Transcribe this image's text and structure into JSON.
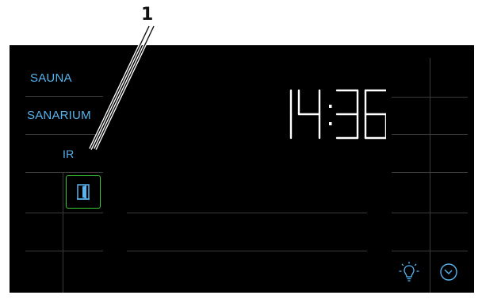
{
  "callout": {
    "number": "1"
  },
  "menu": {
    "items": [
      {
        "label": "SAUNA"
      },
      {
        "label": "SANARIUM"
      },
      {
        "label": "IR"
      }
    ]
  },
  "clock": {
    "time": "14:36"
  },
  "icons": {
    "door": "door-icon",
    "light": "light-bulb-icon",
    "timer": "clock-icon"
  },
  "colors": {
    "background": "#000000",
    "menu_text": "#57b4ee",
    "door_frame": "#38c830",
    "segment": "#ffffff"
  }
}
